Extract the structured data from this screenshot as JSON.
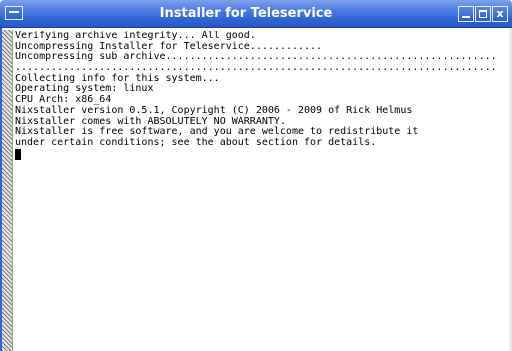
{
  "window": {
    "title": "Installer for Teleservice",
    "menu_icon": "window-menu-icon",
    "controls": {
      "minimize_icon": "minimize-icon",
      "maximize_icon": "maximize-icon",
      "close_icon": "close-icon",
      "close_glyph": "x"
    }
  },
  "terminal": {
    "lines": [
      "Verifying archive integrity... All good.",
      "Uncompressing Installer for Teleservice............",
      "Uncompressing sub archive.......................................................",
      "................................................................................",
      "Collecting info for this system...",
      "Operating system: linux",
      "CPU Arch: x86_64",
      "Nixstaller version 0.5.1, Copyright (C) 2006 - 2009 of Rick Helmus",
      "Nixstaller comes with ABSOLUTELY NO WARRANTY.",
      "Nixstaller is free software, and you are welcome to redistribute it",
      "under certain conditions; see the about section for details."
    ]
  },
  "colors": {
    "titlebar": "#2f64d4",
    "terminal_background": "#ffffff",
    "terminal_text": "#000000"
  }
}
